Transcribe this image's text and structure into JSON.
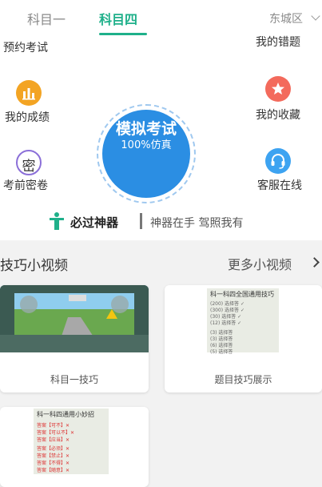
{
  "tabs": [
    {
      "label": "科目一",
      "active": false
    },
    {
      "label": "科目四",
      "active": true
    }
  ],
  "city": "东城区",
  "features": {
    "book_exam": "预约考试",
    "my_mistakes": "我的错题",
    "my_scores": "我的成绩",
    "my_favorites": "我的收藏",
    "secret_paper": "考前密卷",
    "secret_icon_char": "密",
    "service": "客服在线",
    "mock_exam_title": "模拟考试",
    "mock_exam_sub": "100%仿真"
  },
  "must_pass": {
    "title": "必过神器",
    "slogan": "神器在手  驾照我有"
  },
  "videos": {
    "title": "技巧小视频",
    "more": "更多小视频",
    "cards": [
      {
        "label": "科目一技巧"
      },
      {
        "label": "题目技巧展示"
      },
      {
        "label": ""
      }
    ]
  },
  "doc_card2": {
    "title": "科一科四全国通用技巧",
    "lines": [
      "(200) 选择答 ✓",
      "(300) 选择答 ✓",
      "(30) 选择答 ✓",
      "(12) 选择答 ✓",
      "(3) 选择答",
      "(3) 选择答",
      "(6) 选择答",
      "(5) 选择答"
    ]
  },
  "doc_card3": {
    "title": "科一科四通用小妙招",
    "lines": [
      "答案【可不】✕",
      "答案【可以不】✕",
      "答案【应当】✕",
      "答案【必须】✕",
      "答案【禁止】✕",
      "答案【不得】✕",
      "答案【随意】✕"
    ]
  },
  "colors": {
    "accent": "#1fb08a",
    "mock_exam_blue": "#2b8ee3",
    "score_orange": "#f3a423",
    "fav_red": "#f36a5c",
    "secret_purple": "#8b6fd8",
    "service_blue": "#3da3f1"
  },
  "icons": {
    "scores": "bar-chart-icon",
    "favorites": "star-icon",
    "service": "headset-icon",
    "must_pass": "trophy-person-icon",
    "more": "chevron-right-icon",
    "city": "chevron-down-icon"
  }
}
